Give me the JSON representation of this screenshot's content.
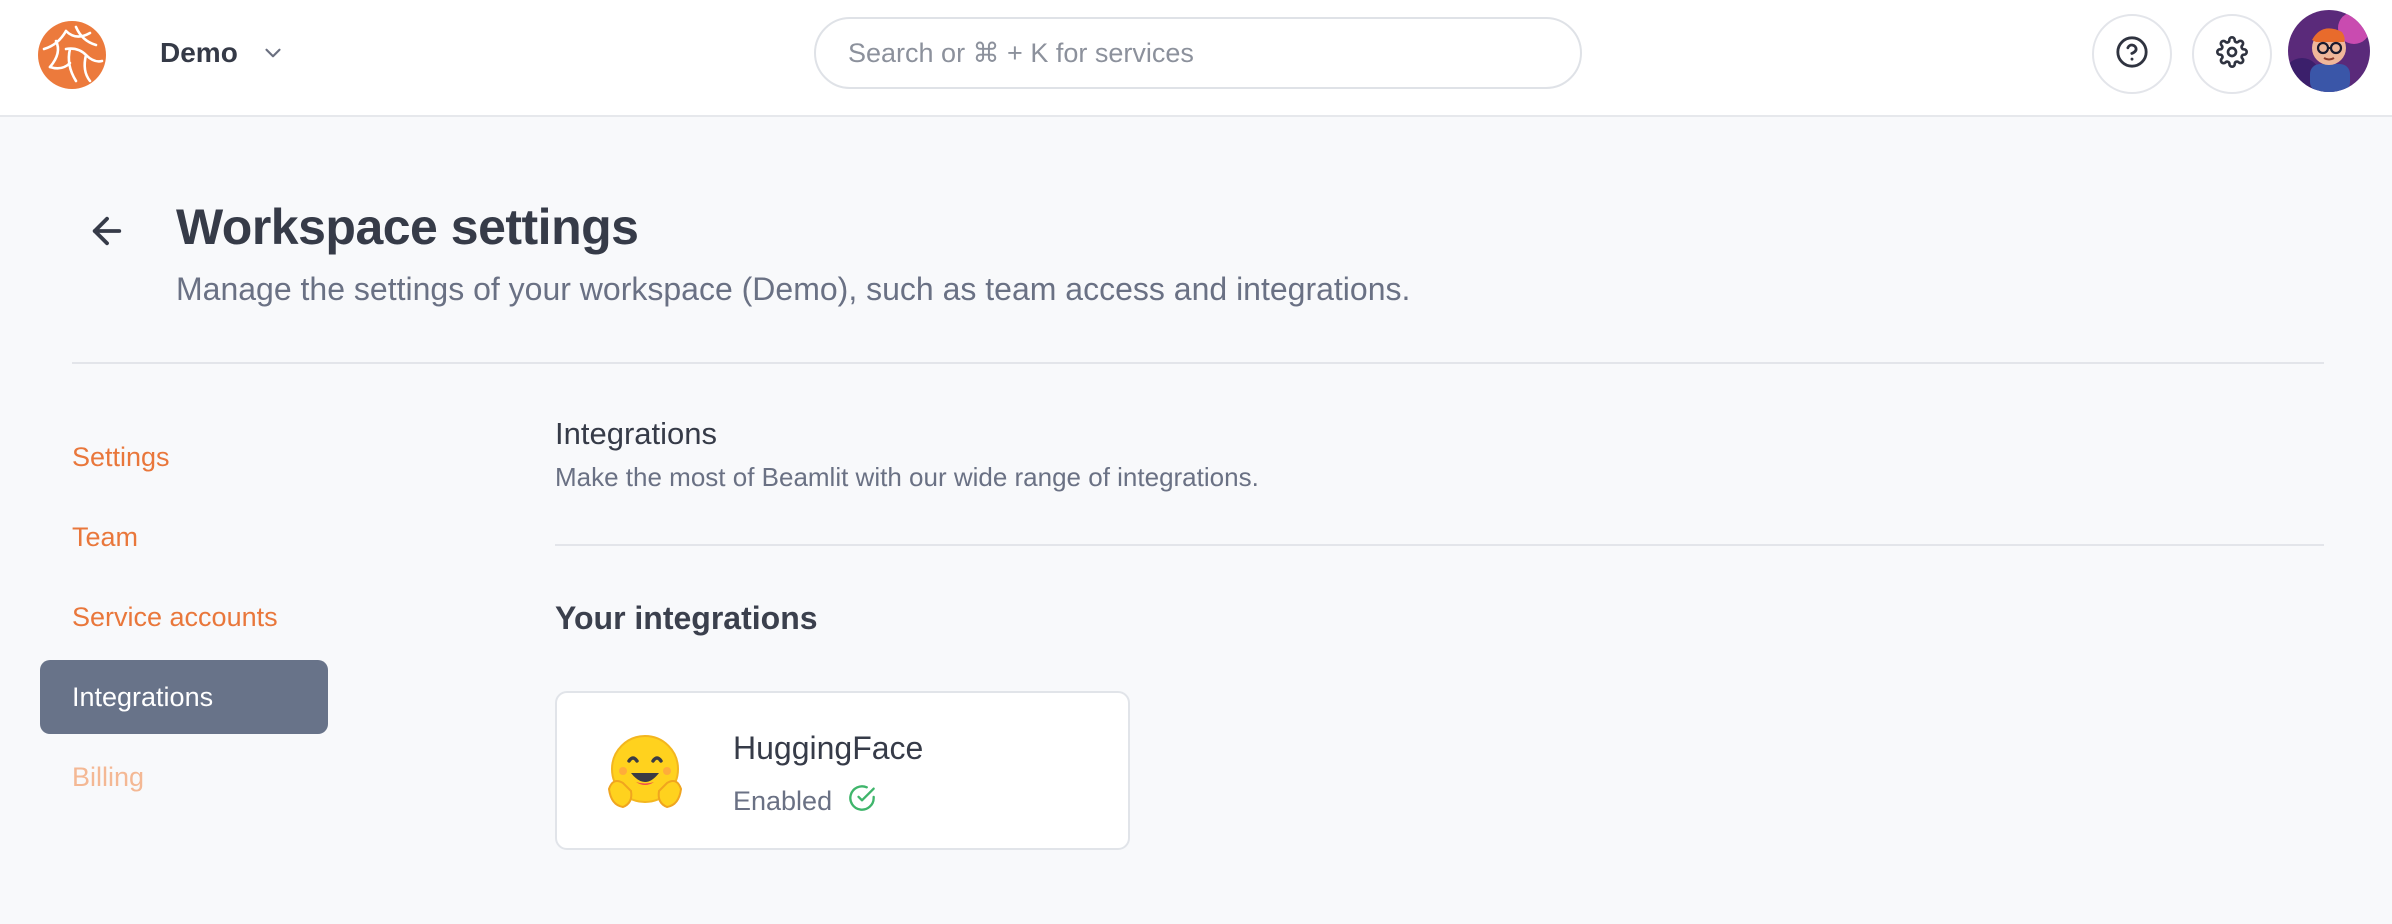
{
  "header": {
    "workspace_name": "Demo",
    "search_placeholder": "Search or ⌘ + K for services",
    "help_icon": "help-circle-icon",
    "settings_icon": "gear-icon"
  },
  "page": {
    "title": "Workspace settings",
    "subtitle": "Manage the settings of your workspace (Demo), such as team access and integrations."
  },
  "sidebar": {
    "items": [
      {
        "label": "Settings",
        "state": "normal"
      },
      {
        "label": "Team",
        "state": "normal"
      },
      {
        "label": "Service accounts",
        "state": "normal"
      },
      {
        "label": "Integrations",
        "state": "active"
      },
      {
        "label": "Billing",
        "state": "disabled"
      }
    ]
  },
  "integrations": {
    "title": "Integrations",
    "description": "Make the most of Beamlit with our wide range of integrations.",
    "your_title": "Your integrations",
    "cards": [
      {
        "name": "HuggingFace",
        "status": "Enabled",
        "icon": "hugging-face-emoji"
      }
    ]
  },
  "colors": {
    "accent": "#e9773b",
    "active_bg": "#687389",
    "success": "#3fb56b"
  }
}
